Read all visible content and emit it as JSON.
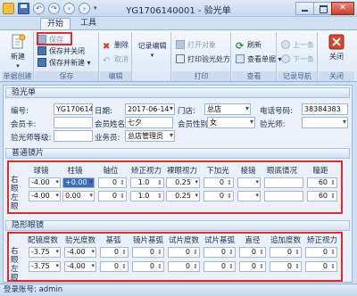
{
  "window": {
    "title": "YG1706140001 - 验光单",
    "close_glyph": "✕"
  },
  "tabs": [
    {
      "label": "开始"
    },
    {
      "label": "工具"
    }
  ],
  "ribbon": {
    "groups": {
      "create": {
        "label": "单据创建",
        "new_label": "新建"
      },
      "save": {
        "label": "保存",
        "save": "保存",
        "save_close": "保存并关闭",
        "save_new": "保存并新建"
      },
      "edit": {
        "label": "编辑",
        "delete": "删除",
        "cancel": "取消"
      },
      "record": {
        "label": "记录编辑"
      },
      "print": {
        "label": "打印",
        "open_obj": "打开对象",
        "print_obj": "打印验光处方"
      },
      "view": {
        "label": "查看",
        "refresh": "刷新",
        "view_doc": "查看单据"
      },
      "nav": {
        "label": "记录导航",
        "prev": "上一条",
        "next": "下一条"
      },
      "close": {
        "label": "关闭",
        "close": "关闭"
      }
    }
  },
  "sections": {
    "optometry": {
      "title": "验光单",
      "fields": {
        "code_label": "编号:",
        "code_value": "YG1706140",
        "date_label": "日期:",
        "date_value": "2017-06-14",
        "store_label": "门店:",
        "store_value": "总店",
        "phone_label": "电话号码:",
        "phone_value": "38384383",
        "card_label": "会员卡:",
        "card_value": "",
        "name_label": "会员姓名:",
        "name_value": "七夕",
        "gender_label": "会员性别:",
        "gender_value": "女",
        "optometrist_label": "验光师:",
        "optometrist_value": "",
        "level_label": "验光师等级:",
        "level_value": "",
        "sales_label": "业务员:",
        "sales_value": "总店管理员"
      }
    },
    "glasses": {
      "title": "普通镜片",
      "columns": [
        "球镜",
        "柱镜",
        "轴位",
        "矫正视力",
        "裸眼视力",
        "下加光",
        "棱镜",
        "眼底情况",
        "瞳距"
      ],
      "side_labels": {
        "right": "右眼",
        "left": "左眼"
      },
      "rows": [
        {
          "sph": "-4.00",
          "cyl": "+0.00",
          "axis": "0",
          "va": "1.0",
          "naked": "0.25",
          "add": "0",
          "prism": "",
          "fundus": "",
          "pd": "60"
        },
        {
          "sph": "-4.00",
          "cyl": "0.00",
          "axis": "0",
          "va": "1.0",
          "naked": "0.25",
          "add": "0",
          "prism": "",
          "fundus": "",
          "pd": "60"
        }
      ]
    },
    "contact": {
      "title": "隐形眼镜",
      "columns": [
        "配镜度数",
        "验光度数",
        "基弧",
        "镜片基弧",
        "试片度数",
        "试片基弧",
        "直径",
        "追加度数",
        "矫正视力"
      ],
      "side_labels": {
        "right": "右眼",
        "left": "左眼"
      },
      "rows": [
        {
          "fit": "-3.75",
          "opt": "-4.00",
          "bc": "0",
          "lens_bc": "0",
          "trial": "0",
          "trial_bc": "0",
          "dia": "0",
          "extra": "0",
          "va": "0"
        },
        {
          "fit": "-3.75",
          "opt": "-4.00",
          "bc": "0",
          "lens_bc": "0",
          "trial": "0",
          "trial_bc": "0",
          "dia": "0",
          "extra": "0",
          "va": "0"
        }
      ]
    }
  },
  "status": {
    "text": "登录账号: admin"
  }
}
